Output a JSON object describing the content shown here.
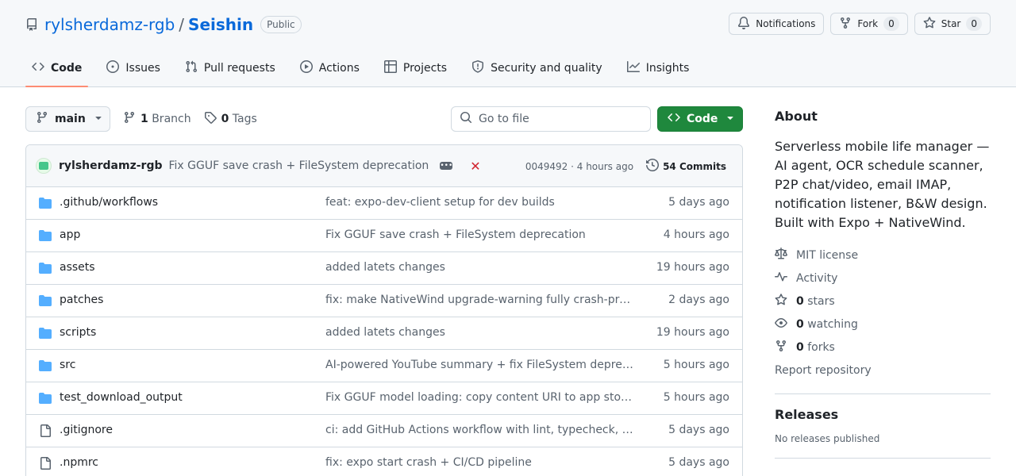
{
  "repo": {
    "owner": "rylsherdamz-rgb",
    "separator": "/",
    "name": "Seishin",
    "visibility": "Public"
  },
  "header_actions": {
    "notifications_label": "Notifications",
    "fork_label": "Fork",
    "fork_count": "0",
    "star_label": "Star",
    "star_count": "0"
  },
  "tabs": [
    {
      "label": "Code",
      "icon": "code-icon",
      "active": true
    },
    {
      "label": "Issues",
      "icon": "issue-icon"
    },
    {
      "label": "Pull requests",
      "icon": "pull-request-icon"
    },
    {
      "label": "Actions",
      "icon": "play-icon"
    },
    {
      "label": "Projects",
      "icon": "table-icon"
    },
    {
      "label": "Security and quality",
      "icon": "shield-icon"
    },
    {
      "label": "Insights",
      "icon": "graph-icon"
    }
  ],
  "toolbar": {
    "branch": "main",
    "branch_count": "1",
    "branch_label": "Branch",
    "tag_count": "0",
    "tag_label": "Tags",
    "goto_placeholder": "Go to file",
    "code_button": "Code"
  },
  "latest_commit": {
    "author": "rylsherdamz-rgb",
    "message": "Fix GGUF save crash + FileSystem deprecation",
    "sha_time": "0049492 · 4 hours ago",
    "commit_count": "54 Commits",
    "status": "failed"
  },
  "files": [
    {
      "name": ".github/workflows",
      "type": "folder",
      "commit": "feat: expo-dev-client setup for dev builds",
      "time": "5 days ago"
    },
    {
      "name": "app",
      "type": "folder",
      "commit": "Fix GGUF save crash + FileSystem deprecation",
      "time": "4 hours ago"
    },
    {
      "name": "assets",
      "type": "folder",
      "commit": "added latets changes",
      "time": "19 hours ago"
    },
    {
      "name": "patches",
      "type": "folder",
      "commit": "fix: make NativeWind upgrade-warning fully crash-proof",
      "time": "2 days ago"
    },
    {
      "name": "scripts",
      "type": "folder",
      "commit": "added latets changes",
      "time": "19 hours ago"
    },
    {
      "name": "src",
      "type": "folder",
      "commit": "AI-powered YouTube summary + fix FileSystem deprecati…",
      "time": "5 hours ago"
    },
    {
      "name": "test_download_output",
      "type": "folder",
      "commit": "Fix GGUF model loading: copy content URI to app storage",
      "time": "5 hours ago"
    },
    {
      "name": ".gitignore",
      "type": "file",
      "commit": "ci: add GitHub Actions workflow with lint, typecheck, test,…",
      "time": "5 days ago"
    },
    {
      "name": ".npmrc",
      "type": "file",
      "commit": "fix: expo start crash + CI/CD pipeline",
      "time": "5 days ago"
    }
  ],
  "about": {
    "title": "About",
    "description": "Serverless mobile life manager — AI agent, OCR schedule scanner, P2P chat/video, email IMAP, notification listener, B&W design. Built with Expo + NativeWind.",
    "license": "MIT license",
    "activity": "Activity",
    "stars_count": "0",
    "stars_label": "stars",
    "watching_count": "0",
    "watching_label": "watching",
    "forks_count": "0",
    "forks_label": "forks",
    "report": "Report repository"
  },
  "releases": {
    "title": "Releases",
    "empty": "No releases published"
  },
  "colors": {
    "accent_link": "#0969da",
    "code_button_bg": "#1f883d",
    "active_tab_underline": "#fd8c73",
    "folder_icon": "#54aeff",
    "fail": "#d1242f"
  }
}
